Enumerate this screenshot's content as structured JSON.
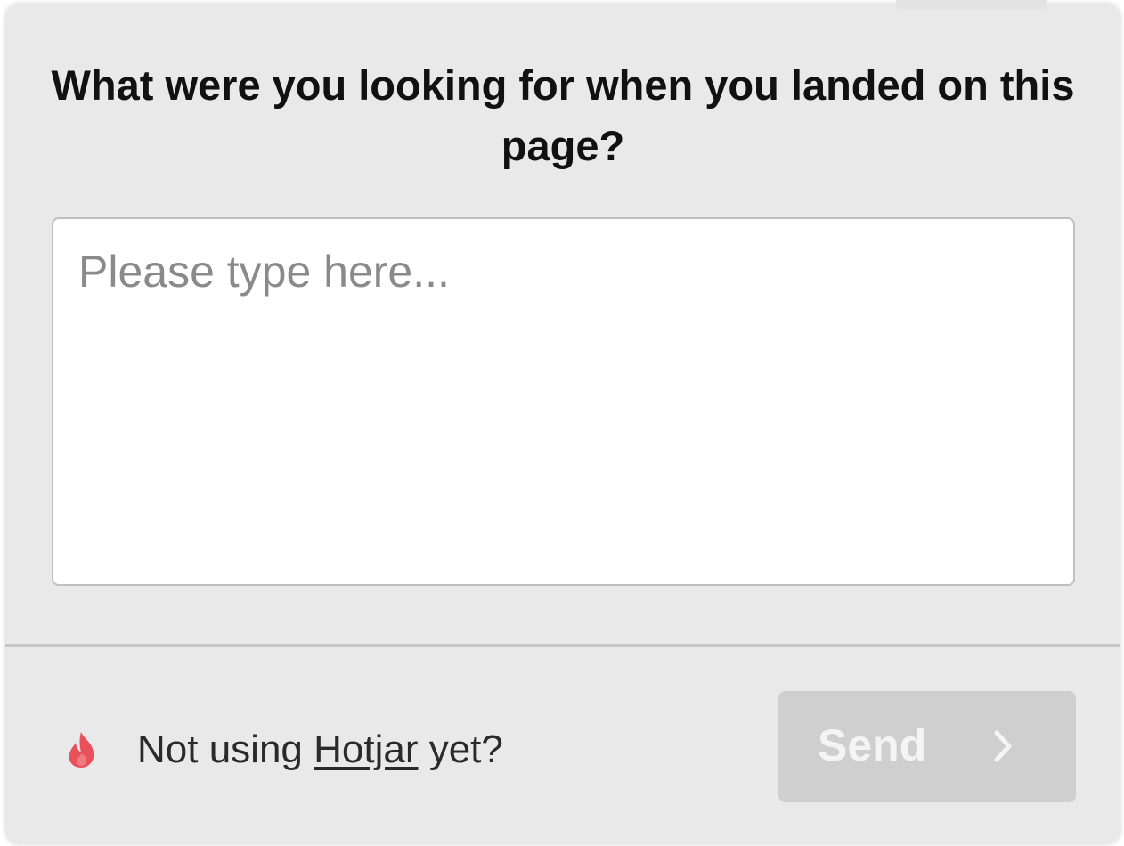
{
  "survey": {
    "question": "What were you looking for when you landed on this page?",
    "answer_placeholder": "Please type here...",
    "answer_value": ""
  },
  "footer": {
    "promo_prefix": "Not using ",
    "promo_link": "Hotjar",
    "promo_suffix": " yet?",
    "send_label": "Send",
    "send_icon": "chevron-right-icon",
    "brand_icon": "flame-icon"
  },
  "colors": {
    "panel_bg": "#e9e9e9",
    "send_button_disabled_bg": "#cfcfcf",
    "brand_flame": "#e8505b"
  }
}
